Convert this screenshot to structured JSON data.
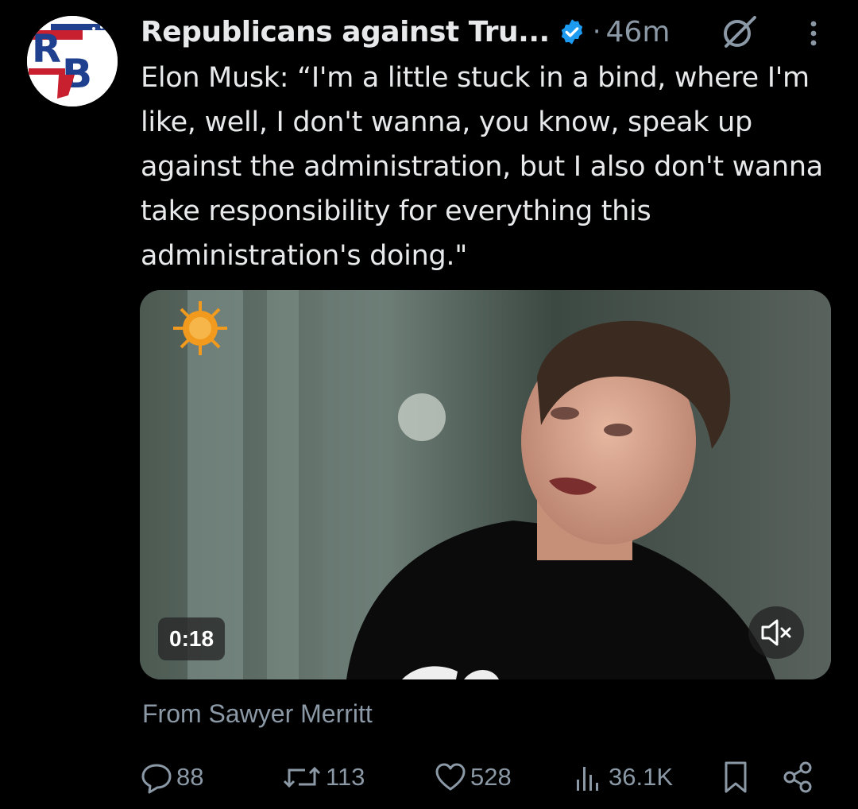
{
  "tweet": {
    "author": "Republicans against Tru...",
    "separator": "·",
    "time": "46m",
    "text": "Elon Musk: “I'm a little stuck in a bind, where I'm like, well, I don't wanna, you know, speak up against the administration, but I also don't wanna take responsibility for everything this administration's doing.\"",
    "avatar_letters": "RB",
    "media": {
      "duration": "0:18"
    },
    "source": "From Sawyer Merritt"
  },
  "actions": {
    "replies": "88",
    "reposts": "113",
    "likes": "528",
    "views": "36.1K"
  },
  "colors": {
    "background": "#000000",
    "text": "#e7e9ea",
    "muted": "#8b98a5",
    "verified": "#1d9bf0",
    "avatar_red": "#c8202e",
    "avatar_blue": "#1f3f8f"
  },
  "icons": [
    "verified-badge-icon",
    "grok-icon",
    "more-icon",
    "mute-icon",
    "reply-icon",
    "repost-icon",
    "like-icon",
    "views-icon",
    "bookmark-icon",
    "share-icon"
  ]
}
